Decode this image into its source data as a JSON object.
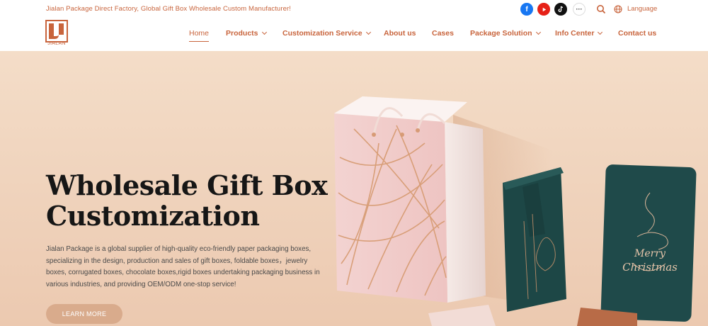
{
  "topbar": {
    "tagline": "Jialan Package Direct Factory, Global Gift Box Wholesale Custom  Manufacturer!",
    "social_icons": [
      "facebook-icon",
      "youtube-icon",
      "tiktok-icon",
      "more-icon"
    ],
    "more_label": "···",
    "language_label": "Language"
  },
  "logo": {
    "text": "JIALAN"
  },
  "nav": {
    "items": [
      {
        "label": "Home",
        "active": true
      },
      {
        "label": "Products",
        "dropdown": true
      },
      {
        "label": "Customization Service",
        "dropdown": true
      },
      {
        "label": "About us"
      },
      {
        "label": "Cases"
      },
      {
        "label": "Package Solution",
        "dropdown": true
      },
      {
        "label": "Info Center",
        "dropdown": true
      },
      {
        "label": "Contact us"
      }
    ]
  },
  "hero": {
    "title_line1": "Wholesale Gift Box",
    "title_line2": "Customization",
    "description": "Jialan Package is a global supplier of high-quality eco-friendly paper packaging boxes, specializing in the design, production and sales of gift boxes, foldable boxes，jewelry boxes, corrugated boxes, chocolate boxes,rigid boxes undertaking packaging business in various industries, and providing OEM/ODM one-stop service!",
    "button_label": "LEARN MORE",
    "card_text_line1": "Merry",
    "card_text_line2": "Christmas"
  },
  "colors": {
    "accent": "#c8643c",
    "hero_bg": "#f4ddc8",
    "button": "#d9ab8c",
    "teal_box": "#1f4a4a"
  }
}
